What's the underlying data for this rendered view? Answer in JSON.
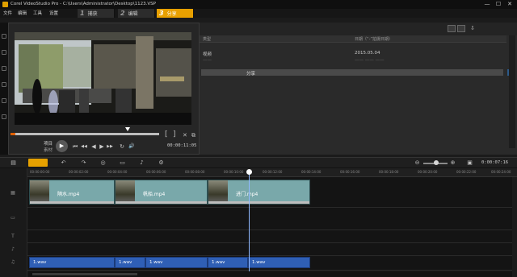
{
  "window": {
    "title": "Corel VideoStudio Pro - C:\\Users\\Administrator\\Desktop\\1123.VSP",
    "controls": {
      "minimize": "—",
      "maximize": "☐",
      "close": "✕"
    }
  },
  "menu": {
    "items": [
      "文件",
      "编辑",
      "工具",
      "设置"
    ]
  },
  "steps": [
    {
      "num": "1",
      "label": "捕获"
    },
    {
      "num": "2",
      "label": "编辑"
    },
    {
      "num": "3",
      "label": "分享"
    }
  ],
  "player": {
    "mode_labels": {
      "project": "项目",
      "clip": "素材"
    },
    "timecode": "00:00:11:05",
    "controls": {
      "play": "▶",
      "home": "⏮",
      "prev": "◀◀",
      "step_back": "◀",
      "step_fwd": "▶",
      "next": "▶▶",
      "repeat": "↻",
      "volume": "🔊",
      "mark_in": "[",
      "mark_out": "]",
      "cut": "✕",
      "enlarge": "⧉"
    }
  },
  "library": {
    "headers": {
      "type": "类型",
      "date": "日期（“-”拍摄日期）"
    },
    "rows": [
      {
        "type": "视频",
        "date": "2015.05.04"
      },
      {
        "type": "——",
        "date": "—— —— ——"
      }
    ],
    "share_label": "分享",
    "expand_icon": "»"
  },
  "timeline": {
    "timecode": "0:00:07:16",
    "ruler": [
      "00:00:00:00",
      "00:00:02:00",
      "00:00:04:00",
      "00:00:06:00",
      "00:00:08:00",
      "00:00:10:00",
      "00:00:12:00",
      "00:00:14:00",
      "00:00:16:00",
      "00:00:18:00",
      "00:00:20:00",
      "00:00:22:00",
      "00:00:24:00"
    ],
    "video_clips": [
      "隔水.mp4",
      "帆船.mp4",
      "进门.mp4"
    ],
    "audio_clips": [
      "1.wav",
      "1.wav",
      "1.wav",
      "1.wav",
      "1.wav"
    ],
    "tool_icons": [
      "storyboard-icon",
      "timeline-icon",
      "undo-icon",
      "redo-icon",
      "record-icon",
      "title-icon",
      "mix-icon",
      "fx-icon",
      "zoom-out-icon",
      "zoom-in-icon",
      "fit-icon"
    ]
  },
  "colors": {
    "accent": "#e8a000",
    "video_clip": "#79a8aa",
    "audio_clip": "#2f5fb5"
  }
}
